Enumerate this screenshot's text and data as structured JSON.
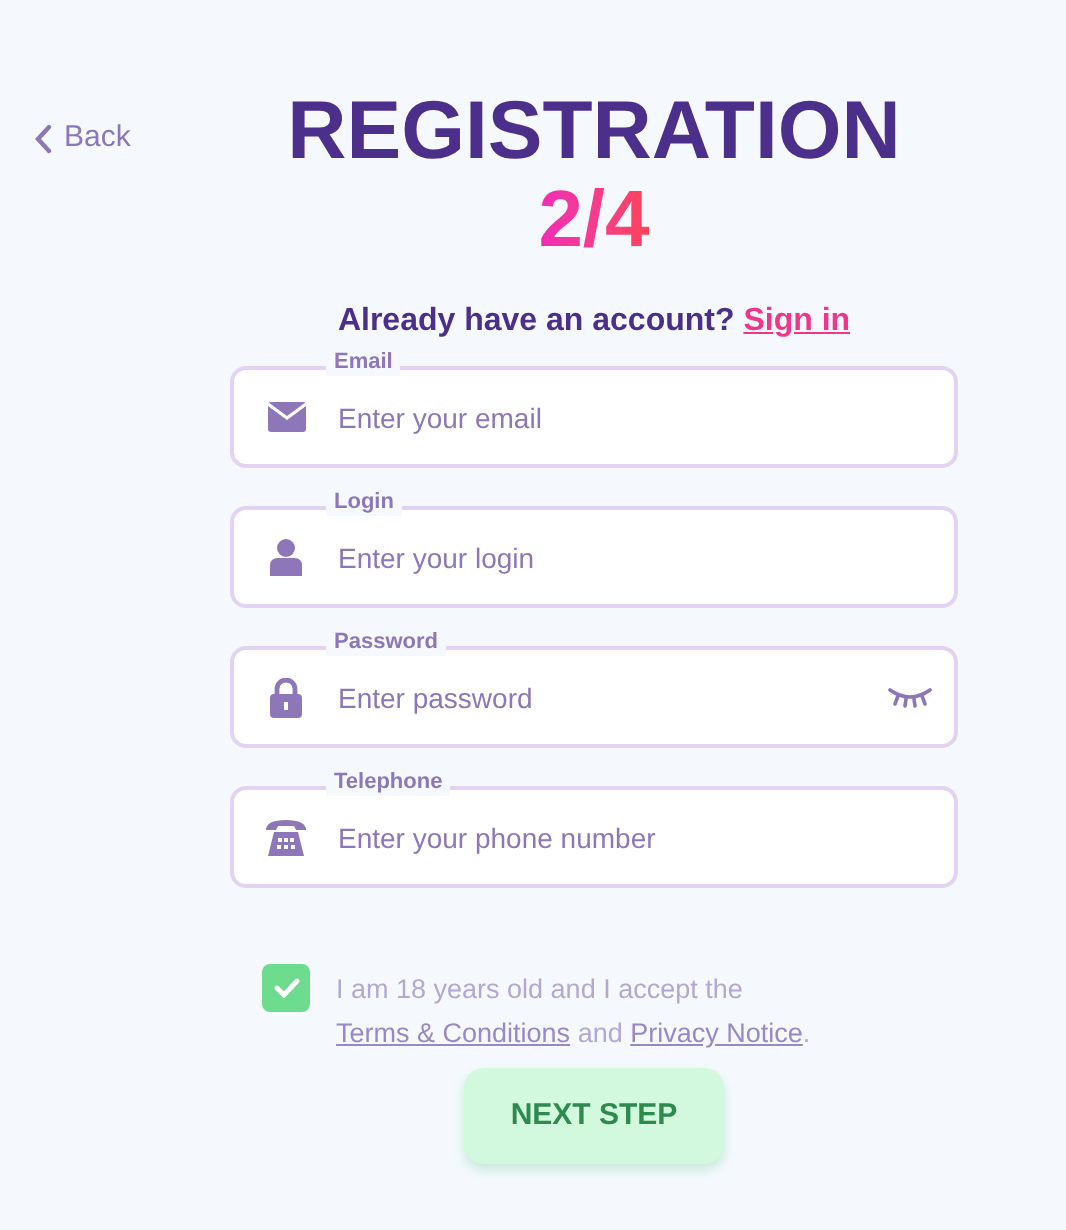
{
  "back": {
    "label": "Back"
  },
  "title": "REGISTRATION",
  "step": "2/4",
  "signin_prompt": {
    "text": "Already have an account?",
    "link": "Sign in"
  },
  "fields": [
    {
      "kind": "email",
      "label": "Email",
      "placeholder": "Enter your email"
    },
    {
      "kind": "login",
      "label": "Login",
      "placeholder": "Enter your login"
    },
    {
      "kind": "password",
      "label": "Password",
      "placeholder": "Enter password"
    },
    {
      "kind": "phone",
      "label": "Telephone",
      "placeholder": "Enter your phone number"
    }
  ],
  "consent": {
    "checked": true,
    "text": "I am 18 years old and I accept the",
    "link_1": "Terms & Conditions",
    "joiner": "and",
    "link_2": "Privacy Notice",
    "end": "."
  },
  "next_button": {
    "label": "NEXT STEP",
    "disabled": true
  }
}
